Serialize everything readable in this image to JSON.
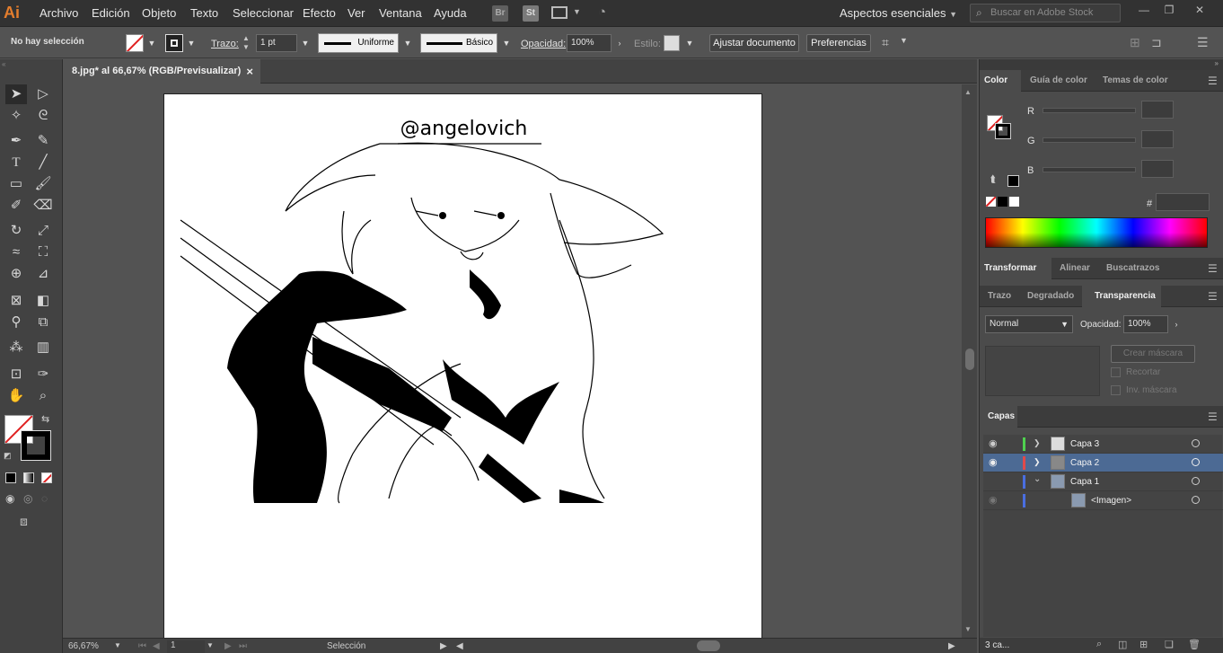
{
  "menubar": {
    "logo": "Ai",
    "items": [
      "Archivo",
      "Edición",
      "Objeto",
      "Texto",
      "Seleccionar",
      "Efecto",
      "Ver",
      "Ventana",
      "Ayuda"
    ],
    "badge_br": "Br",
    "badge_st": "St",
    "workspace": "Aspectos esenciales",
    "stock_placeholder": "Buscar en Adobe Stock"
  },
  "controlbar": {
    "selection": "No hay selección",
    "stroke_label": "Trazo:",
    "stroke_value": "1 pt",
    "profile": "Uniforme",
    "brush": "Básico",
    "opacity_label": "Opacidad:",
    "opacity_value": "100%",
    "style_label": "Estilo:",
    "fit_button": "Ajustar documento",
    "prefs_button": "Preferencias"
  },
  "document": {
    "tab_title": "8.jpg* al 66,67% (RGB/Previsualizar)",
    "close": "×",
    "signature": "@angelovich"
  },
  "statusbar": {
    "zoom": "66,67%",
    "page": "1",
    "mode": "Selección"
  },
  "color_panel": {
    "tabs": [
      "Color",
      "Guía de color",
      "Temas de color"
    ],
    "channels": [
      "R",
      "G",
      "B"
    ],
    "hash": "#"
  },
  "transform_panel": {
    "tabs": [
      "Transformar",
      "Alinear",
      "Buscatrazos"
    ]
  },
  "transparency_panel": {
    "tabs": [
      "Trazo",
      "Degradado",
      "Transparencia"
    ],
    "blend_mode": "Normal",
    "opacity_label": "Opacidad:",
    "opacity_value": "100%",
    "mask_button": "Crear máscara",
    "clip_label": "Recortar",
    "invert_label": "Inv. máscara"
  },
  "layers_panel": {
    "title": "Capas",
    "layers": [
      {
        "name": "Capa 3",
        "color": "#4fd14f",
        "expanded": false,
        "selected": false
      },
      {
        "name": "Capa 2",
        "color": "#e04a4a",
        "expanded": false,
        "selected": true
      },
      {
        "name": "Capa 1",
        "color": "#4a6ee0",
        "expanded": true,
        "selected": false
      },
      {
        "name": "<Imagen>",
        "color": "#4a6ee0",
        "expanded": false,
        "selected": false
      }
    ],
    "footer_count": "3 ca..."
  }
}
